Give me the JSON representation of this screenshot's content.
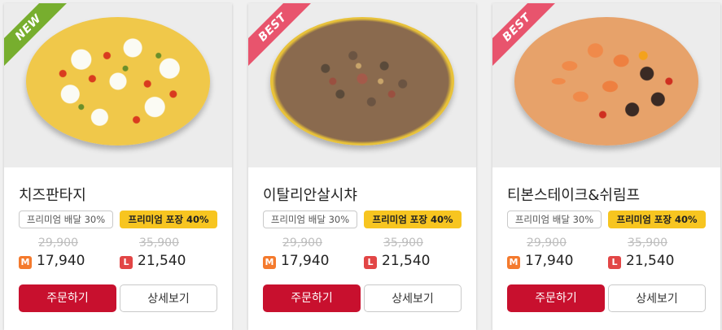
{
  "products": [
    {
      "name": "치즈판타지",
      "ribbon": "NEW",
      "badge_delivery": "프리미엄 배달 30%",
      "badge_takeout": "프리미엄 포장 40%",
      "m_original": "29,900",
      "m_price": "17,940",
      "l_original": "35,900",
      "l_price": "21,540",
      "size_m": "M",
      "size_l": "L",
      "order_label": "주문하기",
      "detail_label": "상세보기"
    },
    {
      "name": "이탈리안살시챠",
      "ribbon": "BEST",
      "badge_delivery": "프리미엄 배달 30%",
      "badge_takeout": "프리미엄 포장 40%",
      "m_original": "29,900",
      "m_price": "17,940",
      "l_original": "35,900",
      "l_price": "21,540",
      "size_m": "M",
      "size_l": "L",
      "order_label": "주문하기",
      "detail_label": "상세보기"
    },
    {
      "name": "티본스테이크&쉬림프",
      "ribbon": "BEST",
      "badge_delivery": "프리미엄 배달 30%",
      "badge_takeout": "프리미엄 포장 40%",
      "m_original": "29,900",
      "m_price": "17,940",
      "l_original": "35,900",
      "l_price": "21,540",
      "size_m": "M",
      "size_l": "L",
      "order_label": "주문하기",
      "detail_label": "상세보기"
    }
  ],
  "colors": {
    "order_button": "#c8102e",
    "takeout_badge": "#f7c520",
    "ribbon_new": "#77ae2e",
    "ribbon_best": "#e8546d",
    "size_m": "#f47a2d",
    "size_l": "#e24646"
  }
}
